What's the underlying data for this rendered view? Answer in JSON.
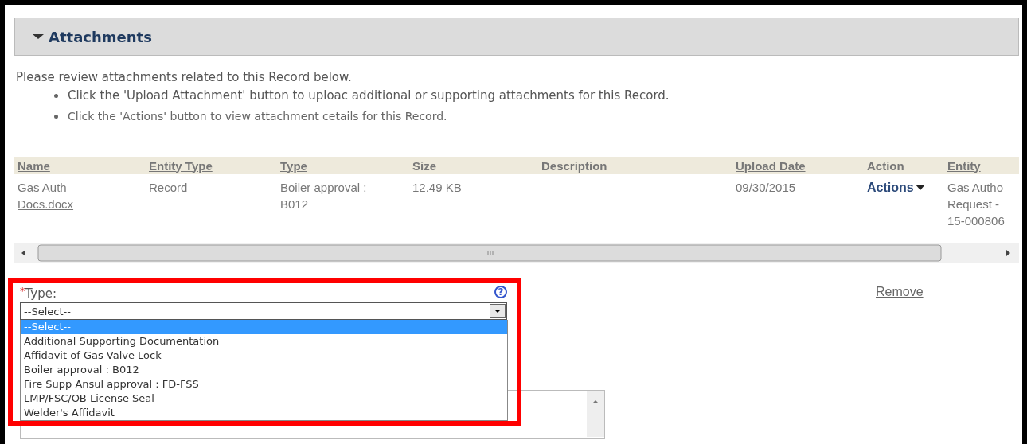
{
  "section": {
    "title": "Attachments",
    "expanded": true
  },
  "intro": "Please review attachments related to this Record below.",
  "bullets": [
    "Click the 'Upload Attachment' button to uploac additional or supporting attachments for this Record.",
    "Click the 'Actions' button to view attachment cetails for this Record."
  ],
  "table": {
    "columns": [
      {
        "label": "Name",
        "link": true
      },
      {
        "label": "Entity Type",
        "link": true
      },
      {
        "label": "Type",
        "link": true
      },
      {
        "label": "Size",
        "link": false
      },
      {
        "label": "Description",
        "link": false
      },
      {
        "label": "Upload Date",
        "link": true
      },
      {
        "label": "Action",
        "link": false
      },
      {
        "label": "Entity",
        "link": true
      }
    ],
    "rows": [
      {
        "cells": [
          {
            "kind": "link",
            "lines": [
              "Gas Auth",
              "Docs.docx"
            ]
          },
          {
            "kind": "text",
            "lines": [
              "Record"
            ]
          },
          {
            "kind": "text",
            "lines": [
              "Boiler approval :",
              "B012"
            ]
          },
          {
            "kind": "text",
            "lines": [
              "12.49 KB"
            ]
          },
          {
            "kind": "empty"
          },
          {
            "kind": "text",
            "lines": [
              "09/30/2015"
            ]
          },
          {
            "kind": "menu",
            "lines": [
              "Actions"
            ]
          },
          {
            "kind": "text",
            "lines": [
              "Gas Autho",
              "Request -",
              "15-000806"
            ]
          }
        ]
      }
    ]
  },
  "form": {
    "label": "Type:",
    "required_marker": "*",
    "help": "?",
    "value": "--Select--",
    "expanded": true,
    "options": [
      {
        "label": "--Select--",
        "selected": true
      },
      {
        "label": "Additional Supporting Documentation",
        "selected": false
      },
      {
        "label": "Affidavit of Gas Valve Lock",
        "selected": false
      },
      {
        "label": "Boiler approval : B012",
        "selected": false
      },
      {
        "label": "Fire Supp Ansul approval : FD-FSS",
        "selected": false
      },
      {
        "label": "LMP/FSC/OB License Seal",
        "selected": false
      },
      {
        "label": "Welder's Affidavit",
        "selected": false
      }
    ],
    "remove": "Remove"
  },
  "annotation": {
    "shown": true
  }
}
